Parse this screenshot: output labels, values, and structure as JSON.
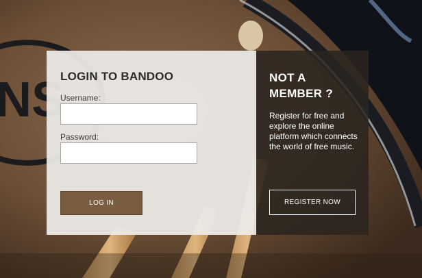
{
  "login": {
    "title": "LOGIN TO BANDOO",
    "username_label": "Username:",
    "username_value": "",
    "password_label": "Password:",
    "password_value": "",
    "login_button": "LOG IN"
  },
  "register": {
    "title": "NOT A MEMBER ?",
    "description": "Register for free and explore the online platform which connects the world of free music.",
    "register_button": "REGISTER NOW"
  },
  "colors": {
    "login_button": "#7a5c40",
    "register_panel": "#2a241e",
    "login_panel": "#eceae7"
  }
}
